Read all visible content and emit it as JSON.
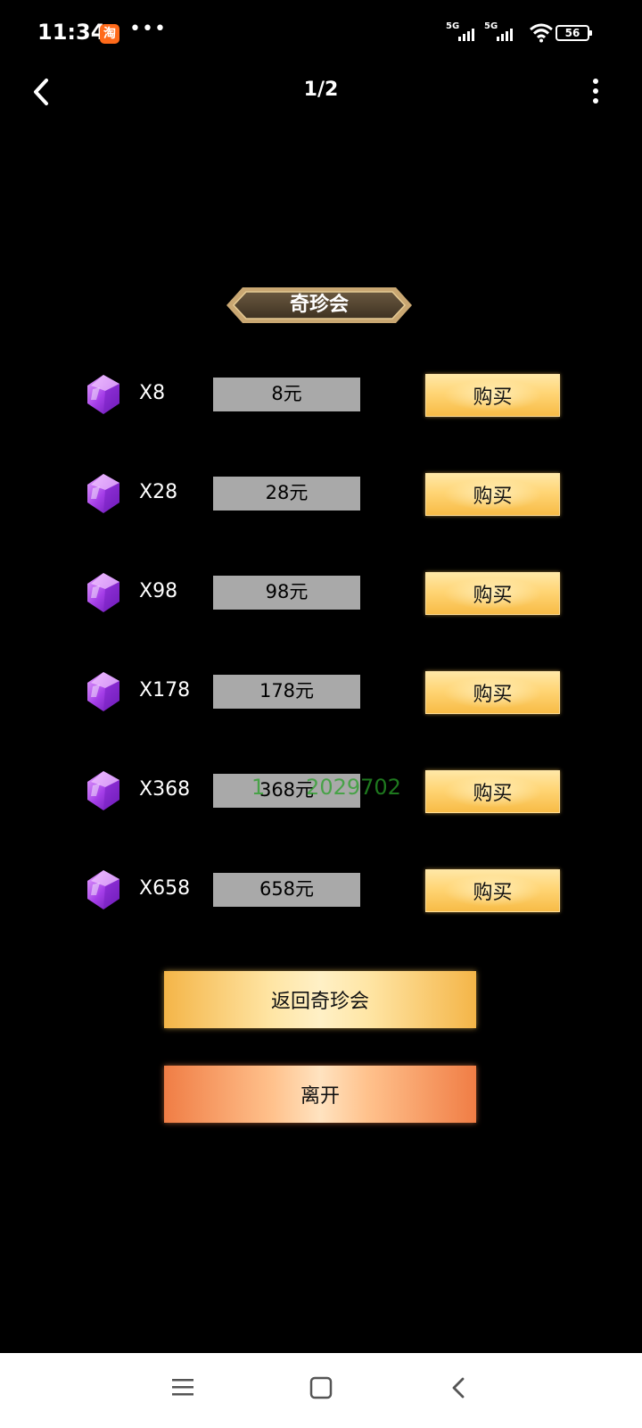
{
  "status_bar": {
    "time": "11:34",
    "app_badge": "淘",
    "overflow": "•••",
    "signal_1_label": "5G",
    "signal_2_label": "5G",
    "battery_level": "56"
  },
  "nav": {
    "page_indicator": "1/2",
    "back_icon": "chevron-left-icon",
    "more_icon": "more-vertical-icon"
  },
  "shop": {
    "title": "奇珍会",
    "buy_label": "购买",
    "items": [
      {
        "qty": "X8",
        "price": "8元"
      },
      {
        "qty": "X28",
        "price": "28元"
      },
      {
        "qty": "X98",
        "price": "98元"
      },
      {
        "qty": "X178",
        "price": "178元"
      },
      {
        "qty": "X368",
        "price": "368元"
      },
      {
        "qty": "X658",
        "price": "658元"
      }
    ],
    "return_label": "返回奇珍会",
    "leave_label": "离开",
    "watermark": "1      2029702"
  },
  "colors": {
    "background": "#000000",
    "gem": "#a640f0",
    "price_box": "#a9a9a9",
    "buy_button": "#ffd575",
    "leave_button": "#f39a63"
  }
}
